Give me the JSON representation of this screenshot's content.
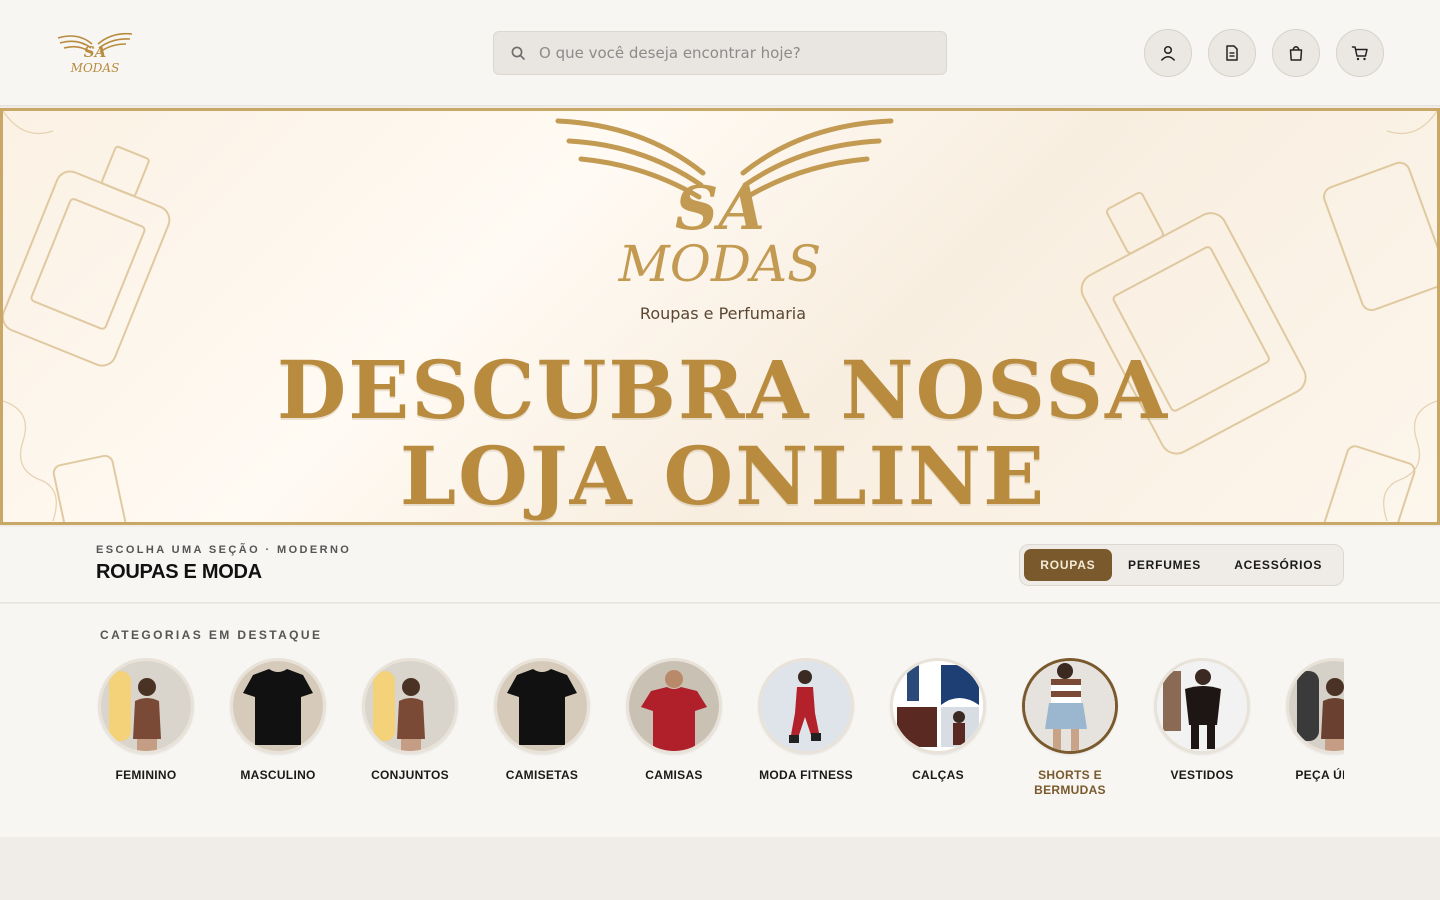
{
  "header": {
    "logo_text": "SA MODAS",
    "search_placeholder": "O que você deseja encontrar hoje?",
    "actions": [
      {
        "icon": "user-icon"
      },
      {
        "icon": "document-icon"
      },
      {
        "icon": "bag-icon"
      },
      {
        "icon": "cart-icon"
      }
    ]
  },
  "banner": {
    "brand": "SA MODAS",
    "tagline": "Roupas e Perfumaria",
    "headline_line1": "DESCUBRA NOSSA",
    "headline_line2": "LOJA ONLINE"
  },
  "section": {
    "eyebrow": "ESCOLHA UMA SEÇÃO · MODERNO",
    "title": "ROUPAS E MODA",
    "tabs": [
      {
        "label": "ROUPAS",
        "active": true
      },
      {
        "label": "PERFUMES",
        "active": false
      },
      {
        "label": "ACESSÓRIOS",
        "active": false
      }
    ]
  },
  "categories": {
    "title": "CATEGORIAS EM DESTAQUE",
    "items": [
      {
        "label": "FEMININO",
        "image": "woman-outfit"
      },
      {
        "label": "MASCULINO",
        "image": "black-tshirt"
      },
      {
        "label": "CONJUNTOS",
        "image": "woman-outfit"
      },
      {
        "label": "CAMISETAS",
        "image": "black-tshirt"
      },
      {
        "label": "CAMISAS",
        "image": "red-shirt"
      },
      {
        "label": "MODA FITNESS",
        "image": "fitness-outfit"
      },
      {
        "label": "CALÇAS",
        "image": "jeans-collage"
      },
      {
        "label": "SHORTS E BERMUDAS",
        "image": "denim-skirt",
        "active": true
      },
      {
        "label": "VESTIDOS",
        "image": "black-dress"
      },
      {
        "label": "PEÇA ÚNICA",
        "image": "woman-outfit"
      }
    ]
  },
  "colors": {
    "accent": "#7a5a2d",
    "gold": "#b98b3e",
    "background": "#f7f6f3"
  }
}
